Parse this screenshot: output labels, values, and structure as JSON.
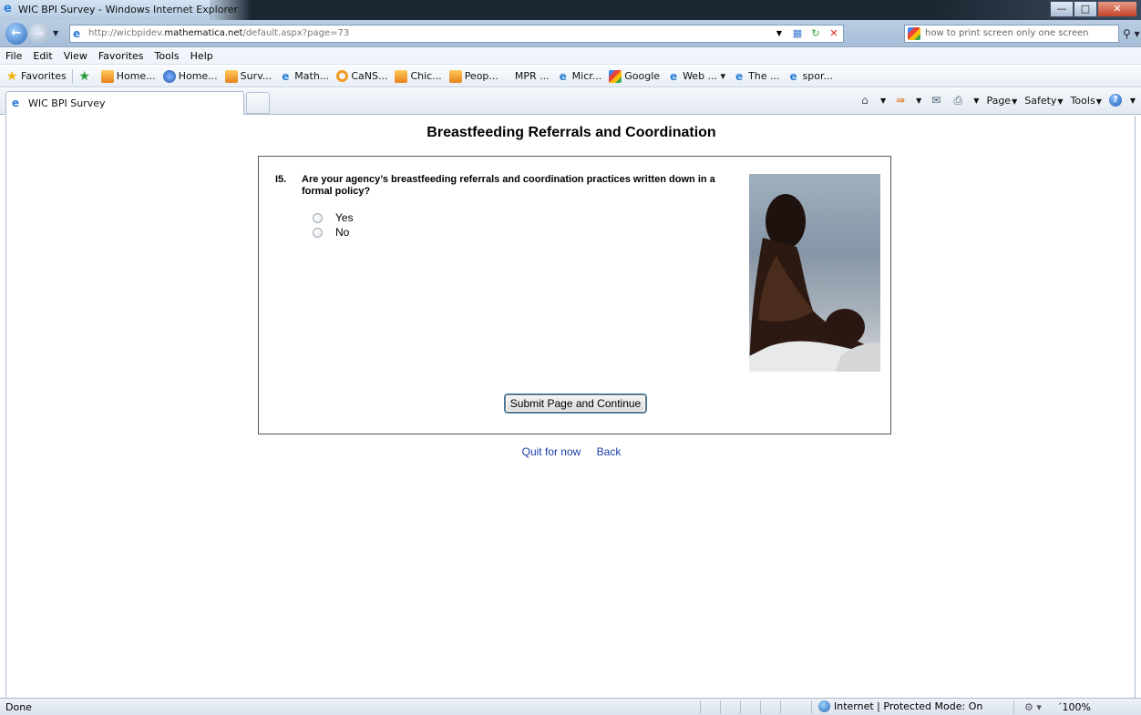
{
  "window": {
    "title": "WIC BPI Survey - Windows Internet Explorer",
    "min_symbol": "—",
    "max_symbol": "□",
    "close_symbol": "✕"
  },
  "address": {
    "url_prefix": "http://wicbpidev.",
    "url_domain": "mathematica.net",
    "url_suffix": "/default.aspx?page=73",
    "search_text": "how to print screen only one screen"
  },
  "menu": [
    "File",
    "Edit",
    "View",
    "Favorites",
    "Tools",
    "Help"
  ],
  "favorites": {
    "label": "Favorites",
    "items": [
      {
        "label": "Home...",
        "icon": "orange"
      },
      {
        "label": "Home...",
        "icon": "blue"
      },
      {
        "label": "Surv...",
        "icon": "orange"
      },
      {
        "label": "Math...",
        "icon": "ie"
      },
      {
        "label": "CaNS...",
        "icon": "ring"
      },
      {
        "label": "Chic...",
        "icon": "orange"
      },
      {
        "label": "Peop...",
        "icon": "orange"
      },
      {
        "label": "MPR ...",
        "icon": "none"
      },
      {
        "label": "Micr...",
        "icon": "ie"
      },
      {
        "label": "Google",
        "icon": "gcolor"
      },
      {
        "label": "Web ... ▾",
        "icon": "ie"
      },
      {
        "label": "The ...",
        "icon": "ie"
      },
      {
        "label": "spor...",
        "icon": "ie"
      }
    ]
  },
  "tab": {
    "label": "WIC BPI Survey"
  },
  "commands": {
    "page": "Page",
    "safety": "Safety",
    "tools": "Tools"
  },
  "survey": {
    "heading": "Breastfeeding Referrals and Coordination",
    "question_number": "I5.",
    "question_text": "Are your agency’s breastfeeding referrals and coordination practices written down in a formal policy?",
    "options": [
      "Yes",
      "No"
    ],
    "submit_label": "Submit Page and Continue",
    "quit_label": "Quit for now",
    "back_label": "Back"
  },
  "status": {
    "text": "Done",
    "zone": "Internet | Protected Mode: On",
    "zoom": "´100%"
  }
}
